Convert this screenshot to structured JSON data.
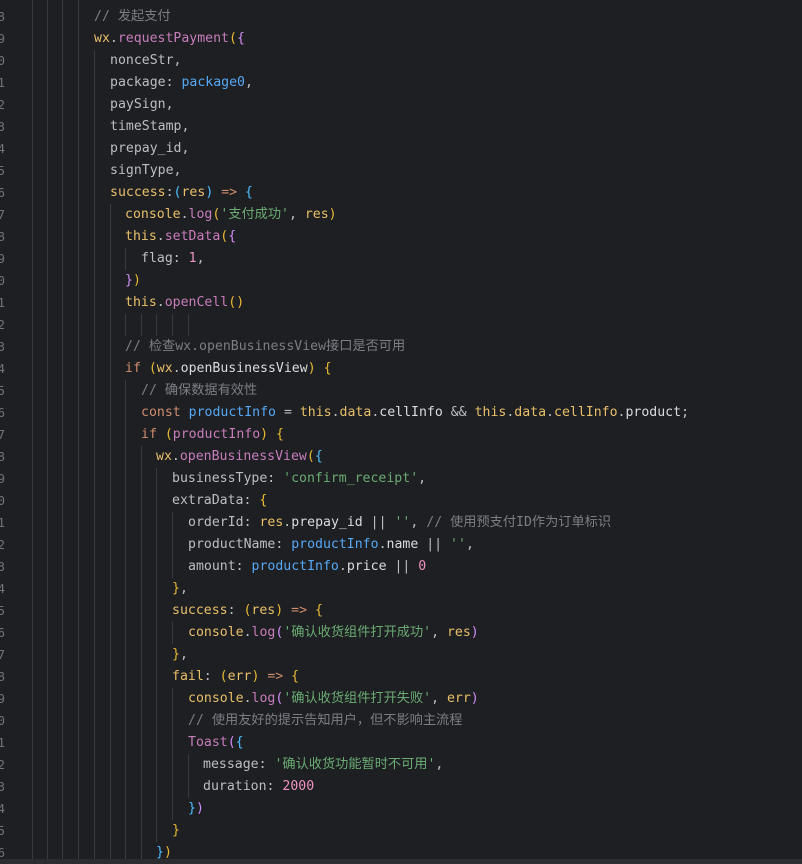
{
  "editor": {
    "colors": {
      "background": "#1e1f22",
      "line_number": "#6f737a",
      "comment": "#7a7e85",
      "string": "#6aab73",
      "number": "#ed94c0",
      "keyword": "#cf8e6d",
      "function": "#56a8f5"
    },
    "line_numbers": [
      "8",
      "9",
      "0",
      "1",
      "2",
      "3",
      "4",
      "5",
      "6",
      "7",
      "8",
      "9",
      "0",
      "1",
      "2",
      "3",
      "4",
      "5",
      "6",
      "7",
      "8",
      "9",
      "0",
      "1",
      "2",
      "3",
      "4",
      "5",
      "6",
      "7",
      "8",
      "9",
      "0",
      "1",
      "2",
      "3",
      "4",
      "5",
      "6"
    ],
    "lines": [
      {
        "indent": 0,
        "tokens": [
          {
            "t": "// 发起支付",
            "c": "comment"
          }
        ]
      },
      {
        "indent": 0,
        "tokens": [
          {
            "t": "wx",
            "c": "func"
          },
          {
            "t": ".",
            "c": "plain"
          },
          {
            "t": "requestPayment",
            "c": "prop"
          },
          {
            "t": "(",
            "c": "p1"
          },
          {
            "t": "{",
            "c": "p2"
          }
        ]
      },
      {
        "indent": 1,
        "tokens": [
          {
            "t": "nonceStr,",
            "c": "plain"
          }
        ]
      },
      {
        "indent": 1,
        "tokens": [
          {
            "t": "package: ",
            "c": "plain"
          },
          {
            "t": "package0",
            "c": "blue"
          },
          {
            "t": ",",
            "c": "plain"
          }
        ]
      },
      {
        "indent": 1,
        "tokens": [
          {
            "t": "paySign,",
            "c": "plain"
          }
        ]
      },
      {
        "indent": 1,
        "tokens": [
          {
            "t": "timeStamp,",
            "c": "plain"
          }
        ]
      },
      {
        "indent": 1,
        "tokens": [
          {
            "t": "prepay_id,",
            "c": "plain"
          }
        ]
      },
      {
        "indent": 1,
        "tokens": [
          {
            "t": "signType,",
            "c": "plain"
          }
        ]
      },
      {
        "indent": 1,
        "tokens": [
          {
            "t": "success",
            "c": "func"
          },
          {
            "t": ":",
            "c": "plain"
          },
          {
            "t": "(",
            "c": "p3"
          },
          {
            "t": "res",
            "c": "func"
          },
          {
            "t": ")",
            "c": "p3"
          },
          {
            "t": " => ",
            "c": "kw"
          },
          {
            "t": "{",
            "c": "p3"
          }
        ]
      },
      {
        "indent": 2,
        "tokens": [
          {
            "t": "console",
            "c": "func"
          },
          {
            "t": ".",
            "c": "plain"
          },
          {
            "t": "log",
            "c": "prop"
          },
          {
            "t": "(",
            "c": "p1"
          },
          {
            "t": "'支付成功'",
            "c": "str"
          },
          {
            "t": ", ",
            "c": "plain"
          },
          {
            "t": "res",
            "c": "func"
          },
          {
            "t": ")",
            "c": "p1"
          }
        ]
      },
      {
        "indent": 2,
        "tokens": [
          {
            "t": "this",
            "c": "func"
          },
          {
            "t": ".",
            "c": "plain"
          },
          {
            "t": "setData",
            "c": "prop"
          },
          {
            "t": "(",
            "c": "p1"
          },
          {
            "t": "{",
            "c": "p2"
          }
        ]
      },
      {
        "indent": 3,
        "tokens": [
          {
            "t": "flag: ",
            "c": "plain"
          },
          {
            "t": "1",
            "c": "num"
          },
          {
            "t": ",",
            "c": "plain"
          }
        ]
      },
      {
        "indent": 2,
        "tokens": [
          {
            "t": "}",
            "c": "p2"
          },
          {
            "t": ")",
            "c": "p1"
          }
        ]
      },
      {
        "indent": 2,
        "tokens": [
          {
            "t": "this",
            "c": "func"
          },
          {
            "t": ".",
            "c": "plain"
          },
          {
            "t": "openCell",
            "c": "prop"
          },
          {
            "t": "()",
            "c": "p1"
          }
        ]
      },
      {
        "indent": 0,
        "tokens": []
      },
      {
        "indent": 2,
        "tokens": [
          {
            "t": "// 检查wx.openBusinessView接口是否可用",
            "c": "comment"
          }
        ]
      },
      {
        "indent": 2,
        "tokens": [
          {
            "t": "if",
            "c": "kw"
          },
          {
            "t": " ",
            "c": "plain"
          },
          {
            "t": "(",
            "c": "p1"
          },
          {
            "t": "wx",
            "c": "func"
          },
          {
            "t": ".",
            "c": "plain"
          },
          {
            "t": "openBusinessView",
            "c": "var"
          },
          {
            "t": ")",
            "c": "p1"
          },
          {
            "t": " ",
            "c": "plain"
          },
          {
            "t": "{",
            "c": "p1"
          }
        ]
      },
      {
        "indent": 3,
        "tokens": [
          {
            "t": "// 确保数据有效性",
            "c": "comment"
          }
        ]
      },
      {
        "indent": 3,
        "tokens": [
          {
            "t": "const",
            "c": "kw"
          },
          {
            "t": " ",
            "c": "plain"
          },
          {
            "t": "productInfo",
            "c": "blue"
          },
          {
            "t": " = ",
            "c": "plain"
          },
          {
            "t": "this",
            "c": "func"
          },
          {
            "t": ".",
            "c": "plain"
          },
          {
            "t": "data",
            "c": "func"
          },
          {
            "t": ".",
            "c": "plain"
          },
          {
            "t": "cellInfo",
            "c": "var"
          },
          {
            "t": " && ",
            "c": "plain"
          },
          {
            "t": "this",
            "c": "func"
          },
          {
            "t": ".",
            "c": "plain"
          },
          {
            "t": "data",
            "c": "func"
          },
          {
            "t": ".",
            "c": "plain"
          },
          {
            "t": "cellInfo",
            "c": "func"
          },
          {
            "t": ".",
            "c": "plain"
          },
          {
            "t": "product",
            "c": "var"
          },
          {
            "t": ";",
            "c": "plain"
          }
        ]
      },
      {
        "indent": 3,
        "tokens": [
          {
            "t": "if",
            "c": "kw"
          },
          {
            "t": " ",
            "c": "plain"
          },
          {
            "t": "(",
            "c": "p1"
          },
          {
            "t": "productInfo",
            "c": "purple"
          },
          {
            "t": ")",
            "c": "p1"
          },
          {
            "t": " ",
            "c": "plain"
          },
          {
            "t": "{",
            "c": "p1"
          }
        ]
      },
      {
        "indent": 4,
        "tokens": [
          {
            "t": "wx",
            "c": "func"
          },
          {
            "t": ".",
            "c": "plain"
          },
          {
            "t": "openBusinessView",
            "c": "prop"
          },
          {
            "t": "(",
            "c": "p1"
          },
          {
            "t": "{",
            "c": "p3"
          }
        ]
      },
      {
        "indent": 5,
        "tokens": [
          {
            "t": "businessType: ",
            "c": "plain"
          },
          {
            "t": "'confirm_receipt'",
            "c": "str"
          },
          {
            "t": ",",
            "c": "plain"
          }
        ]
      },
      {
        "indent": 5,
        "tokens": [
          {
            "t": "extraData: ",
            "c": "plain"
          },
          {
            "t": "{",
            "c": "p1"
          }
        ]
      },
      {
        "indent": 6,
        "tokens": [
          {
            "t": "orderId: ",
            "c": "plain"
          },
          {
            "t": "res",
            "c": "func"
          },
          {
            "t": ".",
            "c": "plain"
          },
          {
            "t": "prepay_id",
            "c": "var"
          },
          {
            "t": " || ",
            "c": "plain"
          },
          {
            "t": "''",
            "c": "str"
          },
          {
            "t": ", ",
            "c": "plain"
          },
          {
            "t": "// 使用预支付ID作为订单标识",
            "c": "comment"
          }
        ]
      },
      {
        "indent": 6,
        "tokens": [
          {
            "t": "productName: ",
            "c": "plain"
          },
          {
            "t": "productInfo",
            "c": "blue"
          },
          {
            "t": ".",
            "c": "plain"
          },
          {
            "t": "name",
            "c": "var"
          },
          {
            "t": " || ",
            "c": "plain"
          },
          {
            "t": "''",
            "c": "str"
          },
          {
            "t": ",",
            "c": "plain"
          }
        ]
      },
      {
        "indent": 6,
        "tokens": [
          {
            "t": "amount: ",
            "c": "plain"
          },
          {
            "t": "productInfo",
            "c": "blue"
          },
          {
            "t": ".",
            "c": "plain"
          },
          {
            "t": "price",
            "c": "var"
          },
          {
            "t": " || ",
            "c": "plain"
          },
          {
            "t": "0",
            "c": "num"
          }
        ]
      },
      {
        "indent": 5,
        "tokens": [
          {
            "t": "}",
            "c": "p1"
          },
          {
            "t": ",",
            "c": "plain"
          }
        ]
      },
      {
        "indent": 5,
        "tokens": [
          {
            "t": "success",
            "c": "func"
          },
          {
            "t": ": ",
            "c": "plain"
          },
          {
            "t": "(",
            "c": "p1"
          },
          {
            "t": "res",
            "c": "func"
          },
          {
            "t": ")",
            "c": "p1"
          },
          {
            "t": " => ",
            "c": "kw"
          },
          {
            "t": "{",
            "c": "p1"
          }
        ]
      },
      {
        "indent": 6,
        "tokens": [
          {
            "t": "console",
            "c": "func"
          },
          {
            "t": ".",
            "c": "plain"
          },
          {
            "t": "log",
            "c": "prop"
          },
          {
            "t": "(",
            "c": "p2"
          },
          {
            "t": "'确认收货组件打开成功'",
            "c": "str"
          },
          {
            "t": ", ",
            "c": "plain"
          },
          {
            "t": "res",
            "c": "func"
          },
          {
            "t": ")",
            "c": "p2"
          }
        ]
      },
      {
        "indent": 5,
        "tokens": [
          {
            "t": "}",
            "c": "p1"
          },
          {
            "t": ",",
            "c": "plain"
          }
        ]
      },
      {
        "indent": 5,
        "tokens": [
          {
            "t": "fail",
            "c": "func"
          },
          {
            "t": ": ",
            "c": "plain"
          },
          {
            "t": "(",
            "c": "p1"
          },
          {
            "t": "err",
            "c": "func"
          },
          {
            "t": ")",
            "c": "p1"
          },
          {
            "t": " => ",
            "c": "kw"
          },
          {
            "t": "{",
            "c": "p1"
          }
        ]
      },
      {
        "indent": 6,
        "tokens": [
          {
            "t": "console",
            "c": "func"
          },
          {
            "t": ".",
            "c": "plain"
          },
          {
            "t": "log",
            "c": "prop"
          },
          {
            "t": "(",
            "c": "p2"
          },
          {
            "t": "'确认收货组件打开失败'",
            "c": "str"
          },
          {
            "t": ", ",
            "c": "plain"
          },
          {
            "t": "err",
            "c": "func"
          },
          {
            "t": ")",
            "c": "p2"
          }
        ]
      },
      {
        "indent": 6,
        "tokens": [
          {
            "t": "// 使用友好的提示告知用户，但不影响主流程",
            "c": "comment"
          }
        ]
      },
      {
        "indent": 6,
        "tokens": [
          {
            "t": "Toast",
            "c": "prop"
          },
          {
            "t": "(",
            "c": "p2"
          },
          {
            "t": "{",
            "c": "p3"
          }
        ]
      },
      {
        "indent": 7,
        "tokens": [
          {
            "t": "message: ",
            "c": "plain"
          },
          {
            "t": "'确认收货功能暂时不可用'",
            "c": "str"
          },
          {
            "t": ",",
            "c": "plain"
          }
        ]
      },
      {
        "indent": 7,
        "tokens": [
          {
            "t": "duration: ",
            "c": "plain"
          },
          {
            "t": "2000",
            "c": "num"
          }
        ]
      },
      {
        "indent": 6,
        "tokens": [
          {
            "t": "}",
            "c": "p3"
          },
          {
            "t": ")",
            "c": "p2"
          }
        ]
      },
      {
        "indent": 5,
        "tokens": [
          {
            "t": "}",
            "c": "p1"
          }
        ]
      },
      {
        "indent": 4,
        "tokens": [
          {
            "t": "}",
            "c": "p3"
          },
          {
            "t": ")",
            "c": "p1"
          }
        ]
      }
    ]
  }
}
